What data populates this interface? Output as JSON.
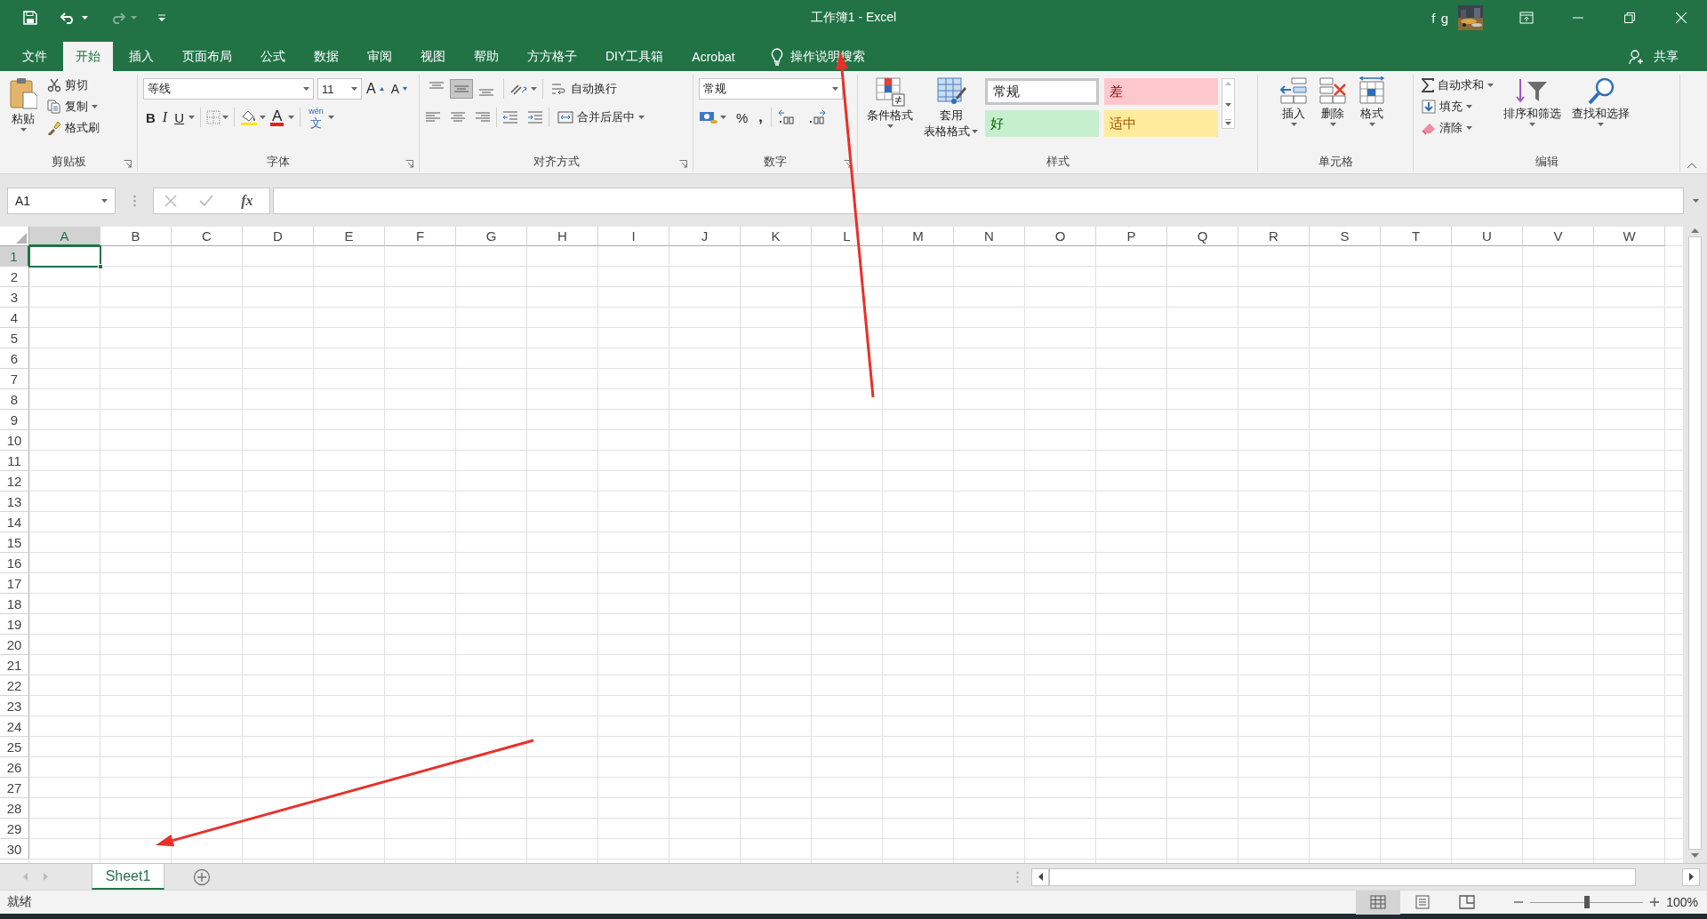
{
  "window": {
    "title": "工作簿1 - Excel",
    "user": "f g"
  },
  "tabs": [
    {
      "label": "文件",
      "selected": false
    },
    {
      "label": "开始",
      "selected": true
    },
    {
      "label": "插入",
      "selected": false
    },
    {
      "label": "页面布局",
      "selected": false
    },
    {
      "label": "公式",
      "selected": false
    },
    {
      "label": "数据",
      "selected": false
    },
    {
      "label": "审阅",
      "selected": false
    },
    {
      "label": "视图",
      "selected": false
    },
    {
      "label": "帮助",
      "selected": false
    },
    {
      "label": "方方格子",
      "selected": false
    },
    {
      "label": "DIY工具箱",
      "selected": false
    },
    {
      "label": "Acrobat",
      "selected": false
    }
  ],
  "tell_me": "操作说明搜索",
  "share": "共享",
  "ribbon": {
    "clipboard": {
      "title": "剪贴板",
      "launcher": true,
      "paste": "粘贴",
      "items": [
        {
          "kind": "cut",
          "label": "剪切"
        },
        {
          "kind": "copy",
          "label": "复制"
        },
        {
          "kind": "painter",
          "label": "格式刷"
        }
      ]
    },
    "font": {
      "title": "字体",
      "launcher": true,
      "name": "等线",
      "size": "11",
      "grow": "A",
      "shrink": "A",
      "styles": [
        "B",
        "I",
        "U"
      ],
      "color_letter": "A",
      "phonetic": {
        "top": "wén",
        "main": "文"
      }
    },
    "alignment": {
      "title": "对齐方式",
      "launcher": true,
      "vertical": [
        {
          "kind": "top",
          "selected": false
        },
        {
          "kind": "middle",
          "selected": true
        },
        {
          "kind": "bottom",
          "selected": false
        }
      ],
      "wrap": "自动换行",
      "merge": "合并后居中"
    },
    "number": {
      "title": "数字",
      "launcher": true,
      "format": "常规",
      "percent": "%",
      "comma": ","
    },
    "styles": {
      "title": "样式",
      "conditional": "条件格式",
      "table": [
        "套用",
        "表格格式"
      ],
      "gallery": [
        {
          "kind": "normal",
          "label": "常规"
        },
        {
          "kind": "bad",
          "label": "差"
        },
        {
          "kind": "good",
          "label": "好"
        },
        {
          "kind": "neutral",
          "label": "适中"
        }
      ]
    },
    "cells": {
      "title": "单元格",
      "buttons": [
        {
          "kind": "insert",
          "label": "插入"
        },
        {
          "kind": "delete",
          "label": "删除"
        },
        {
          "kind": "format",
          "label": "格式"
        }
      ]
    },
    "editing": {
      "title": "编辑",
      "items": [
        {
          "kind": "sum",
          "label": "自动求和"
        },
        {
          "kind": "fill",
          "label": "填充"
        },
        {
          "kind": "clear",
          "label": "清除"
        }
      ],
      "buttons": [
        {
          "kind": "sort",
          "label": "排序和筛选"
        },
        {
          "kind": "find",
          "label": "查找和选择"
        }
      ]
    }
  },
  "formula_bar": {
    "name_box": "A1",
    "function_label": "fx"
  },
  "sheet": {
    "columns": [
      {
        "label": "A",
        "selected": true
      },
      {
        "label": "B",
        "selected": false
      },
      {
        "label": "C",
        "selected": false
      },
      {
        "label": "D",
        "selected": false
      },
      {
        "label": "E",
        "selected": false
      },
      {
        "label": "F",
        "selected": false
      },
      {
        "label": "G",
        "selected": false
      },
      {
        "label": "H",
        "selected": false
      },
      {
        "label": "I",
        "selected": false
      },
      {
        "label": "J",
        "selected": false
      },
      {
        "label": "K",
        "selected": false
      },
      {
        "label": "L",
        "selected": false
      },
      {
        "label": "M",
        "selected": false
      },
      {
        "label": "N",
        "selected": false
      },
      {
        "label": "O",
        "selected": false
      },
      {
        "label": "P",
        "selected": false
      },
      {
        "label": "Q",
        "selected": false
      },
      {
        "label": "R",
        "selected": false
      },
      {
        "label": "S",
        "selected": false
      },
      {
        "label": "T",
        "selected": false
      },
      {
        "label": "U",
        "selected": false
      },
      {
        "label": "V",
        "selected": false
      },
      {
        "label": "W",
        "selected": false
      }
    ],
    "rows": [
      {
        "label": "1",
        "selected": true
      },
      {
        "label": "2",
        "selected": false
      },
      {
        "label": "3",
        "selected": false
      },
      {
        "label": "4",
        "selected": false
      },
      {
        "label": "5",
        "selected": false
      },
      {
        "label": "6",
        "selected": false
      },
      {
        "label": "7",
        "selected": false
      },
      {
        "label": "8",
        "selected": false
      },
      {
        "label": "9",
        "selected": false
      },
      {
        "label": "10",
        "selected": false
      },
      {
        "label": "11",
        "selected": false
      },
      {
        "label": "12",
        "selected": false
      },
      {
        "label": "13",
        "selected": false
      },
      {
        "label": "14",
        "selected": false
      },
      {
        "label": "15",
        "selected": false
      },
      {
        "label": "16",
        "selected": false
      },
      {
        "label": "17",
        "selected": false
      },
      {
        "label": "18",
        "selected": false
      },
      {
        "label": "19",
        "selected": false
      },
      {
        "label": "20",
        "selected": false
      },
      {
        "label": "21",
        "selected": false
      },
      {
        "label": "22",
        "selected": false
      },
      {
        "label": "23",
        "selected": false
      },
      {
        "label": "24",
        "selected": false
      },
      {
        "label": "25",
        "selected": false
      },
      {
        "label": "26",
        "selected": false
      },
      {
        "label": "27",
        "selected": false
      },
      {
        "label": "28",
        "selected": false
      },
      {
        "label": "29",
        "selected": false
      },
      {
        "label": "30",
        "selected": false
      }
    ]
  },
  "sheet_tabs": [
    {
      "label": "Sheet1",
      "selected": true
    }
  ],
  "status_bar": {
    "text": "就绪",
    "views": [
      {
        "kind": "normal",
        "selected": true
      },
      {
        "kind": "page_layout",
        "selected": false
      },
      {
        "kind": "page_break",
        "selected": false
      }
    ],
    "zoom": {
      "level": 0.5,
      "reading": "100%"
    }
  }
}
